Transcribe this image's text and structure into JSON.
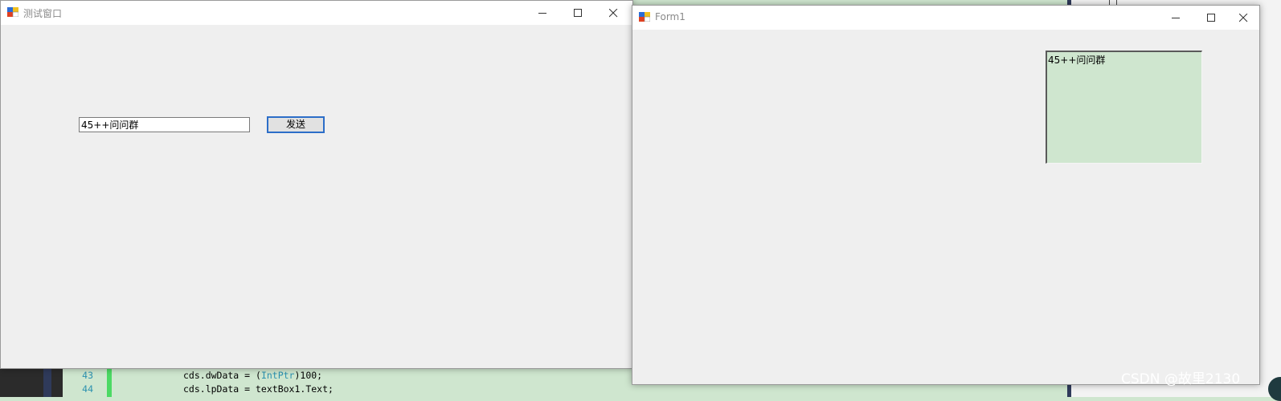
{
  "background": {
    "code_lines": [
      {
        "num": "43",
        "prefix": "cds.dwData = (",
        "type": "IntPtr",
        "suffix": ")100;"
      },
      {
        "num": "44",
        "prefix": "cds.lpData = textBox1.Text;",
        "type": "",
        "suffix": ""
      }
    ],
    "watermark": "CSDN @故里2130"
  },
  "window_test": {
    "title": "测试窗口",
    "textbox_value": "45++问问群",
    "send_button": "发送",
    "icons": [
      "app-icon",
      "minimize-icon",
      "maximize-icon",
      "close-icon"
    ]
  },
  "window_form1": {
    "title": "Form1",
    "received_text": "45++问问群",
    "icons": [
      "app-icon",
      "minimize-icon",
      "maximize-icon",
      "close-icon"
    ]
  },
  "colors": {
    "code_background": "#cfe6cf",
    "focus_border": "#2c6ec8",
    "window_bg": "#efefef"
  }
}
